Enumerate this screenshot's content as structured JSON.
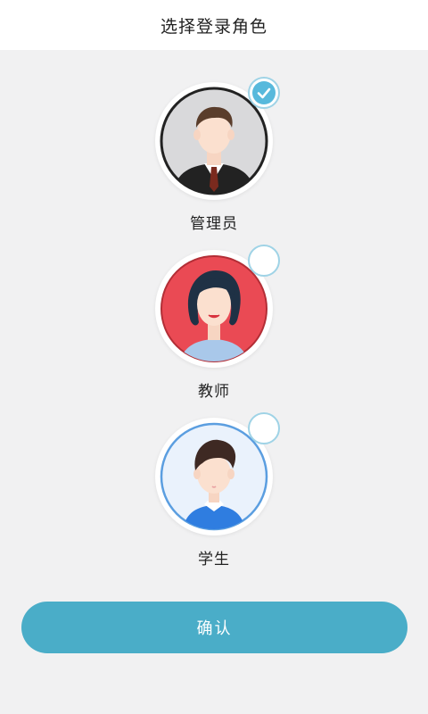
{
  "header": {
    "title": "选择登录角色"
  },
  "roles": [
    {
      "label": "管理员",
      "selected": true,
      "avatar": "businessman-avatar",
      "bg": "#d9d9db"
    },
    {
      "label": "教师",
      "selected": false,
      "avatar": "woman-teacher-avatar",
      "bg": "#ea4a54"
    },
    {
      "label": "学生",
      "selected": false,
      "avatar": "student-boy-avatar",
      "bg": "#eaf2fc"
    }
  ],
  "confirm": {
    "label": "确认"
  },
  "colors": {
    "accent": "#4aadc8",
    "check": "#58b9dc"
  }
}
